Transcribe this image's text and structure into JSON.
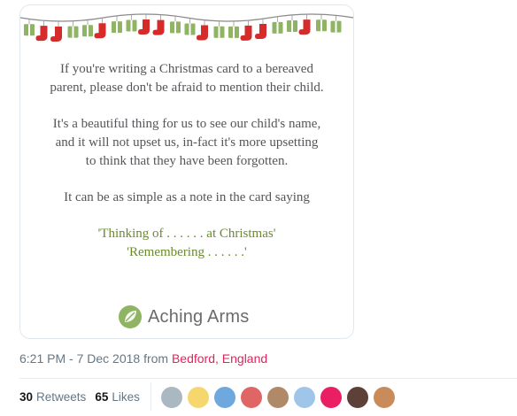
{
  "card": {
    "lines_p1": [
      "If you're writing a Christmas card to a bereaved",
      "parent, please don't be afraid to mention their child."
    ],
    "lines_p2": [
      "It's a beautiful thing for us to see our child's name,",
      "and it will not upset us, in-fact it's more upsetting",
      "to think that they have been forgotten."
    ],
    "line_p3": "It can be as simple as a note in the card saying",
    "quote1": "'Thinking of . . . . . . at Christmas'",
    "quote2": "'Remembering . . . . . .'",
    "logo_text": "Aching Arms",
    "logo_icon": "leaf-circle-icon"
  },
  "meta": {
    "timestamp": "6:21 PM - 7 Dec 2018 from",
    "location": "Bedford, England"
  },
  "stats": {
    "retweets_count": "30",
    "retweets_label": "Retweets",
    "likes_count": "65",
    "likes_label": "Likes"
  },
  "avatars": [
    {
      "name": "default-avatar",
      "color": "#aab8c2"
    },
    {
      "name": "pelps-avatar",
      "color": "#f5d76e"
    },
    {
      "name": "hands-avatar",
      "color": "#6fa8dc"
    },
    {
      "name": "sands-avatar",
      "color": "#e06666"
    },
    {
      "name": "photo-avatar-1",
      "color": "#b08968"
    },
    {
      "name": "diamond-avatar",
      "color": "#9fc5e8"
    },
    {
      "name": "pink-logo-avatar",
      "color": "#e91e63"
    },
    {
      "name": "photo-avatar-2",
      "color": "#5d4037"
    },
    {
      "name": "photo-avatar-3",
      "color": "#c98b5a"
    }
  ],
  "colors": {
    "accent": "#e0245e",
    "muted": "#657786",
    "quote": "#6a8a2c",
    "stocking": "#d62b2b",
    "gift": "#8fb463"
  }
}
